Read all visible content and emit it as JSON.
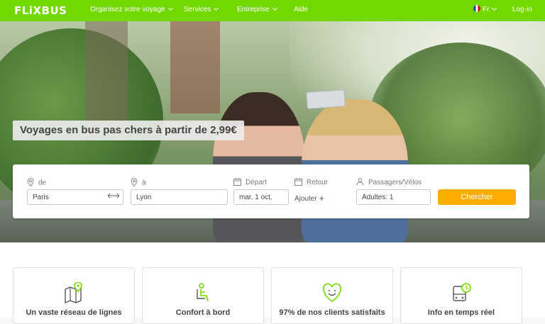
{
  "nav": {
    "logo": "FLiXBUS",
    "items": [
      {
        "label": "Organisez votre voyage",
        "has_dropdown": true
      },
      {
        "label": "Services",
        "has_dropdown": true
      },
      {
        "label": "Entreprise",
        "has_dropdown": true
      },
      {
        "label": "Aide",
        "has_dropdown": false
      }
    ],
    "language": "Fr",
    "login": "Log-in",
    "brand_color": "#73d700"
  },
  "hero": {
    "headline": "Voyages en bus pas chers à partir de 2,99€"
  },
  "search": {
    "from_label": "de",
    "from_value": "Paris",
    "to_label": "à",
    "to_value": "Lyon",
    "departure_label": "Départ",
    "departure_value": "mar. 1 oct.",
    "return_label": "Retour",
    "return_add": "Ajouter",
    "passengers_label": "Passagers/Vélos",
    "passengers_value": "Adultes: 1",
    "submit": "Chercher",
    "submit_color": "#ffad00"
  },
  "features": [
    {
      "title": "Un vaste réseau de lignes",
      "icon": "map-pin-icon"
    },
    {
      "title": "Confort à bord",
      "icon": "seat-icon"
    },
    {
      "title": "97% de nos clients satisfaits",
      "icon": "heart-smile-icon"
    },
    {
      "title": "Info en temps réel",
      "icon": "bus-clock-icon"
    }
  ]
}
